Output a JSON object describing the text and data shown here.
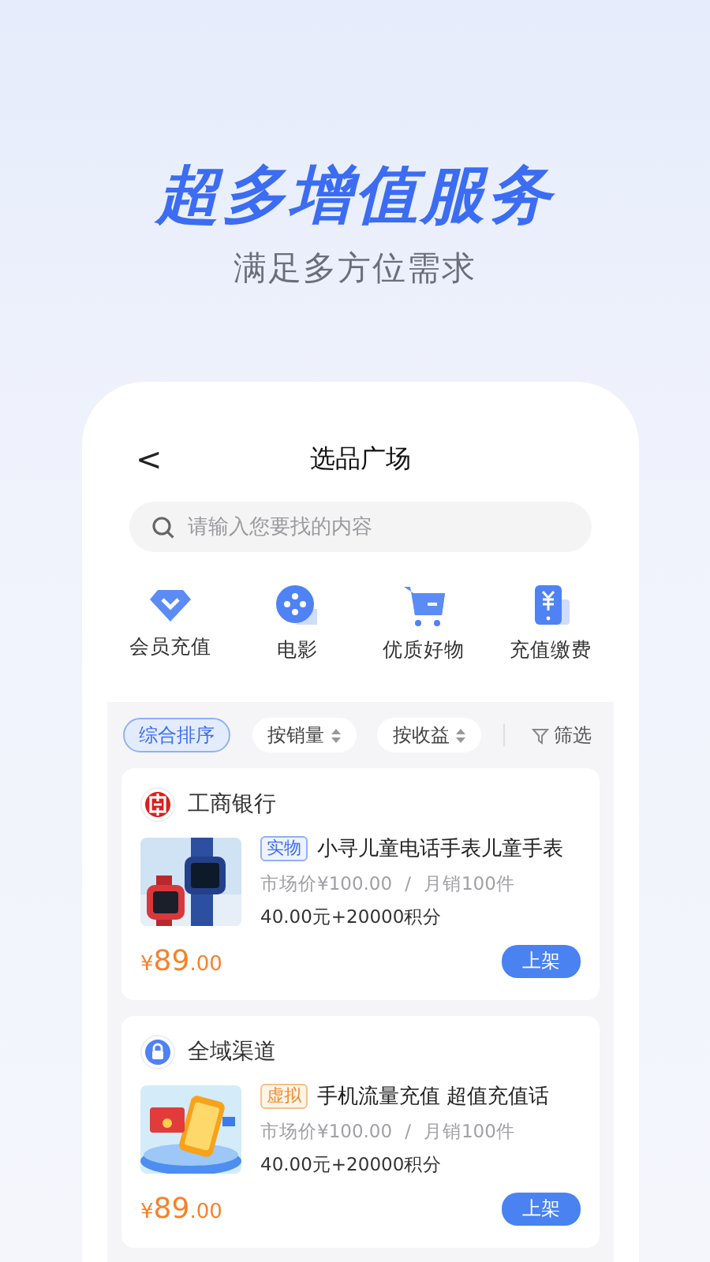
{
  "hero": {
    "headline": "超多增值服务",
    "subtitle": "满足多方位需求"
  },
  "screen": {
    "back": "<",
    "title": "选品广场",
    "search": {
      "placeholder": "请输入您要找的内容"
    }
  },
  "categories": [
    {
      "kind": "diamond",
      "label": "会员充值"
    },
    {
      "kind": "film",
      "label": "电影"
    },
    {
      "kind": "cart",
      "label": "优质好物"
    },
    {
      "kind": "phone",
      "label": "充值缴费"
    }
  ],
  "sort_options": [
    {
      "label": "综合排序",
      "selected": true,
      "sortable": false
    },
    {
      "label": "按销量",
      "selected": false,
      "sortable": true
    },
    {
      "label": "按收益",
      "selected": false,
      "sortable": true
    }
  ],
  "filter": "筛选",
  "products": [
    {
      "kind": "watch",
      "shop": {
        "kind": "bank",
        "name": "工商银行"
      },
      "tag": {
        "kind": "physical",
        "label": "实物"
      },
      "title": "小寻儿童电话手表儿童手表",
      "market_price": "市场价¥100.00",
      "separator": "/",
      "monthly_sales": "月销100件",
      "points": "40.00元+20000积分",
      "currency": "¥",
      "price_main": "89",
      "price_cents": ".00",
      "action": "上架"
    },
    {
      "kind": "phone",
      "shop": {
        "kind": "lock",
        "name": "全域渠道"
      },
      "tag": {
        "kind": "virtual",
        "label": "虚拟"
      },
      "title": "手机流量充值 超值充值话",
      "market_price": "市场价¥100.00",
      "separator": "/",
      "monthly_sales": "月销100件",
      "points": "40.00元+20000积分",
      "currency": "¥",
      "price_main": "89",
      "price_cents": ".00",
      "action": "上架"
    }
  ]
}
